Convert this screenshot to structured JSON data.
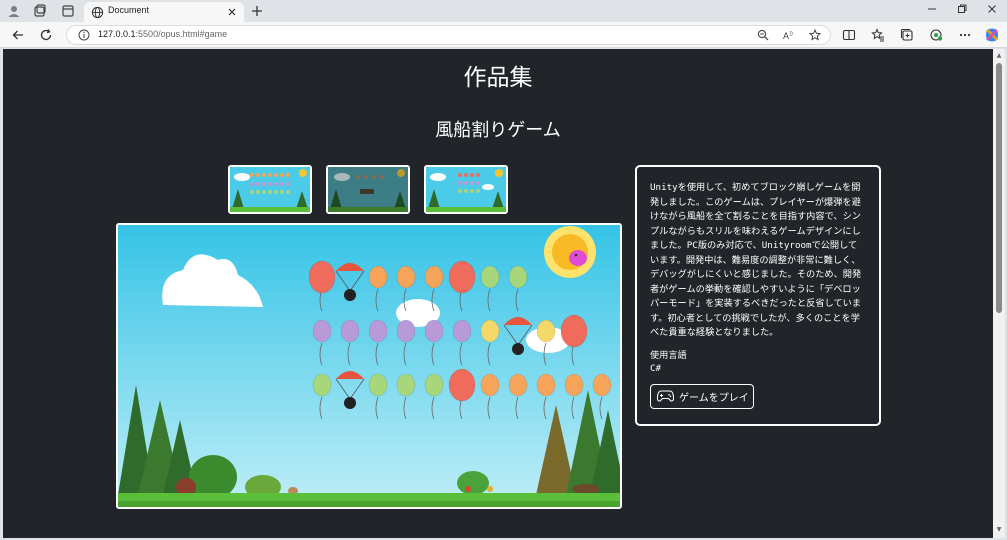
{
  "browser": {
    "tab_title": "Document",
    "url_host": "127.0.0.1",
    "url_rest": ":5500/opus.html#game",
    "icons": [
      "profile-icon",
      "collections-icon",
      "tab-actions-icon",
      "globe-icon",
      "close-icon",
      "new-tab-icon",
      "back-icon",
      "refresh-icon",
      "site-info-icon",
      "zoom-out-icon",
      "read-aloud-icon",
      "favorite-icon",
      "split-screen-icon",
      "favorites-icon",
      "collections-icon",
      "extensions-icon",
      "more-icon",
      "copilot-icon",
      "minimize-icon",
      "maximize-icon",
      "close-window-icon"
    ]
  },
  "page": {
    "title": "作品集",
    "work_title": "風船割りゲーム",
    "description": "Unityを使用して、初めてブロック崩しゲームを開発しました。このゲームは、プレイヤーが爆弾を避けながら風船を全て割ることを目指す内容で、シンプルながらもスリルを味わえるゲームデザインにしました。PC版のみ対応で、Unityroomで公開しています。開発中は、難易度の調整が非常に難しく、デバッグがしにくいと感じました。そのため、開発者がゲームの挙動を確認しやすいように「デベロッパーモード」を実装するべきだったと反省しています。初心者としての挑戦でしたが、多くのことを学べた貴重な経験となりました。",
    "language_label": "使用言語",
    "language_value": "C#",
    "play_button": "ゲームをプレイ"
  },
  "colors": {
    "page_bg": "#212529",
    "sky": "#3ec4e6",
    "grass": "#5bbf3a",
    "balloon_red": "#ef6b5b",
    "balloon_orange": "#f6a45a",
    "balloon_green": "#a8d67a",
    "balloon_purple": "#b99ad8",
    "balloon_yellow": "#f5d86a",
    "parachute": "#e8553f"
  }
}
